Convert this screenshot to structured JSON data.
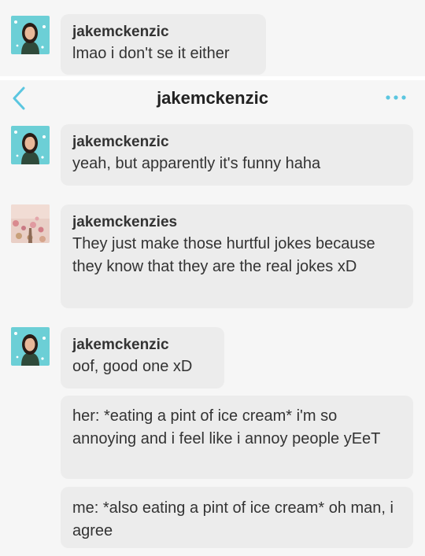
{
  "top_message": {
    "username": "jakemckenzic",
    "text": "lmao i don't se it either"
  },
  "header": {
    "title": "jakemckenzic"
  },
  "messages": [
    {
      "username": "jakemckenzic",
      "text": "yeah, but apparently it's funny haha"
    },
    {
      "username": "jakemckenzies",
      "text": "They just make those hurtful jokes because they know that they are the real jokes xD"
    },
    {
      "username": "jakemckenzic",
      "text": "oof, good one xD"
    },
    {
      "text": "her: *eating a pint of ice cream* i'm so annoying and i feel like i annoy people yEeT"
    },
    {
      "text": "me: *also eating a pint of ice cream* oh man, i agree"
    }
  ],
  "colors": {
    "accent": "#5bc6e0",
    "bubble": "#ececec",
    "background": "#f6f6f6"
  }
}
